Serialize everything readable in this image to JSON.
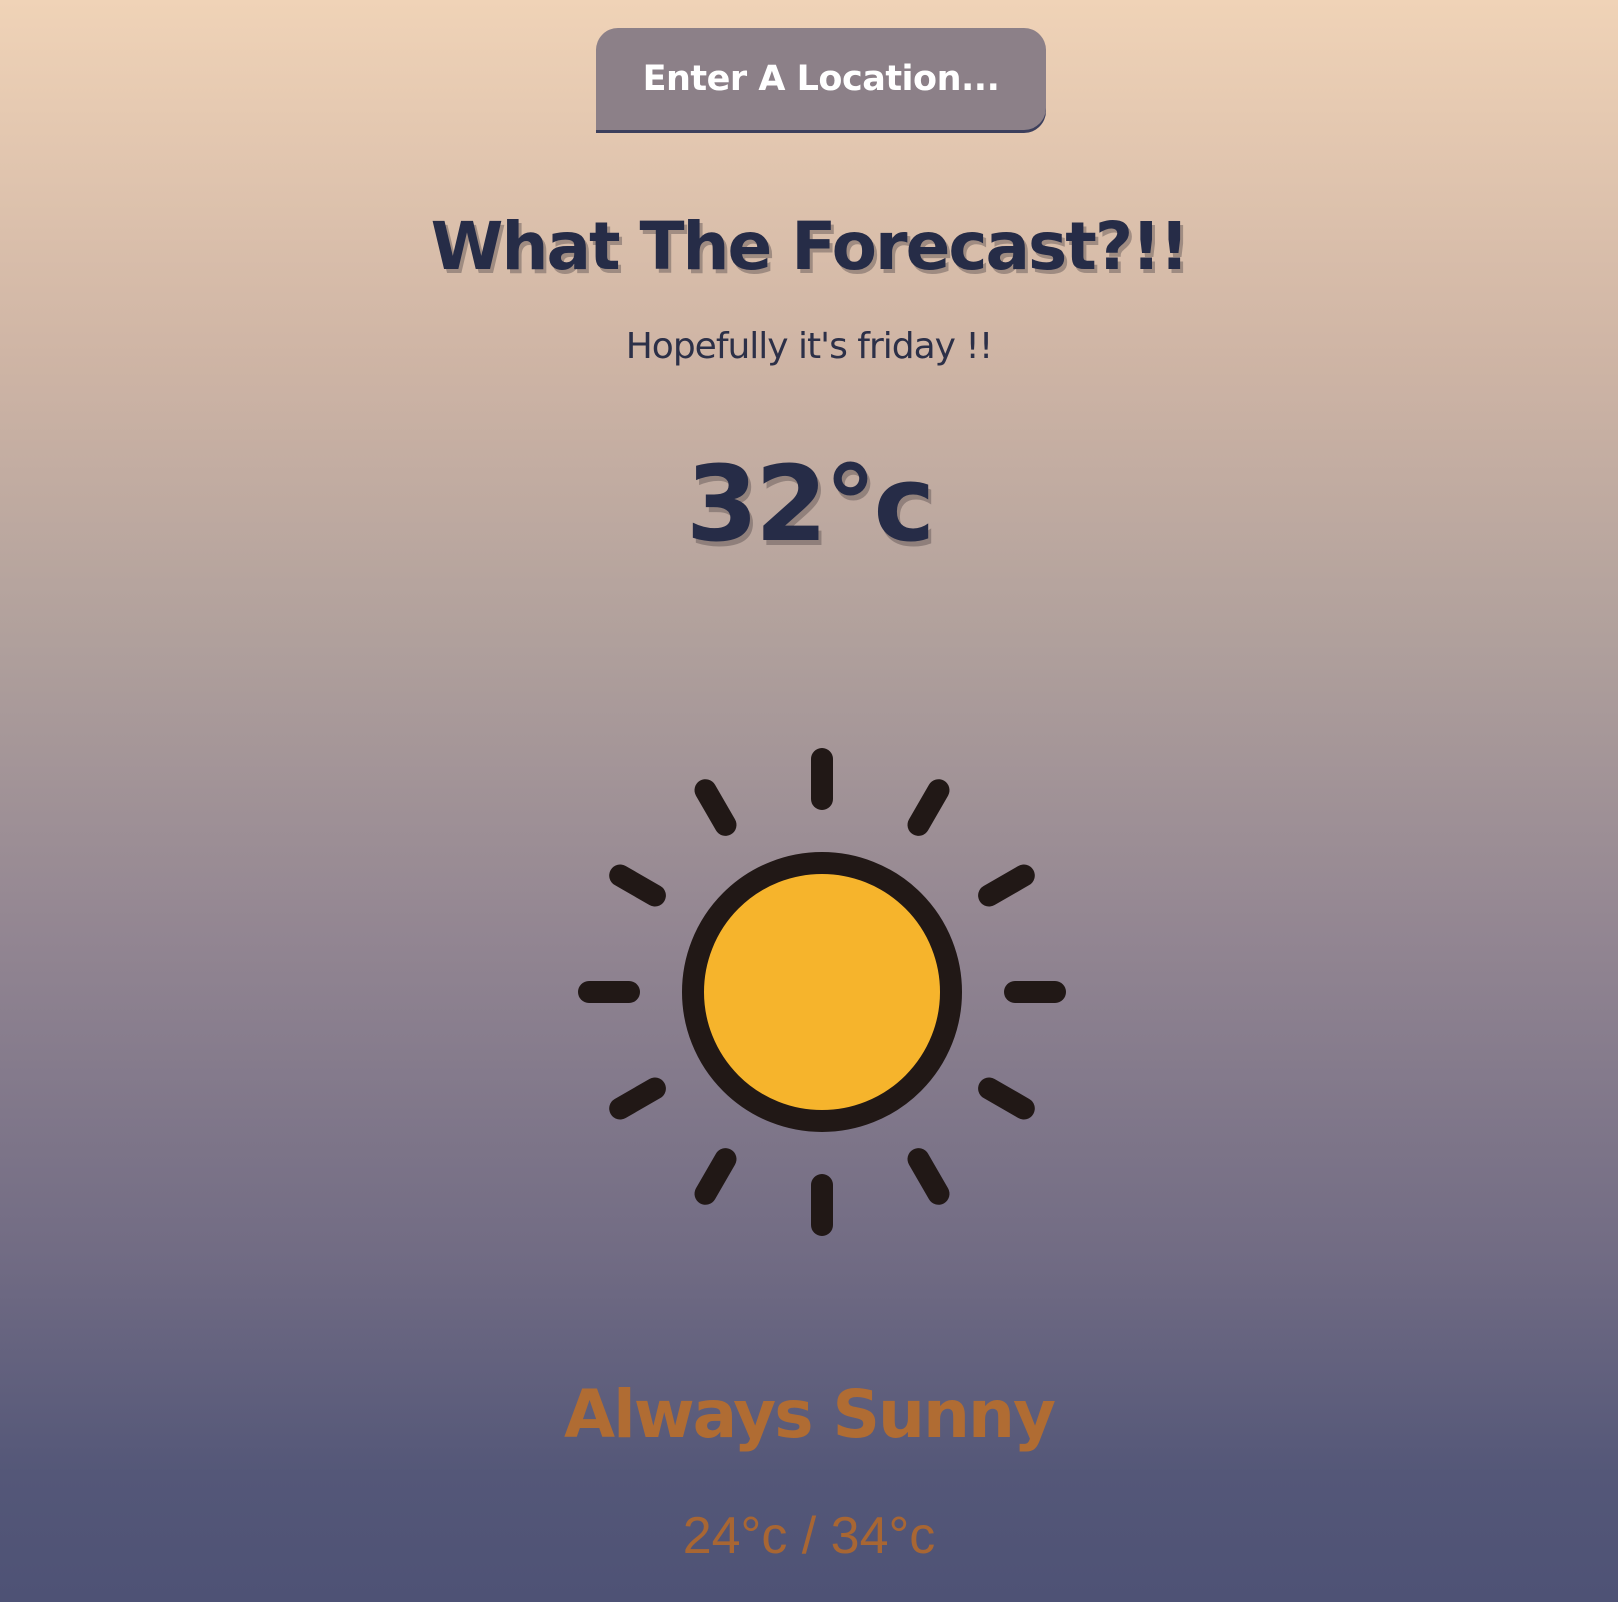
{
  "search": {
    "button_label": "Enter A Location..."
  },
  "header": {
    "title": "What The Forecast?!!",
    "subtitle": "Hopefully it's friday !!"
  },
  "weather": {
    "temperature": "32°c",
    "icon": "sun-icon",
    "condition": "Always Sunny",
    "range": "24°c / 34°c"
  },
  "colors": {
    "title": "#262c47",
    "accent": "#b06c33",
    "sun_fill": "#f6b42c",
    "sun_outline": "#211816",
    "button_bg": "#8c8088"
  }
}
